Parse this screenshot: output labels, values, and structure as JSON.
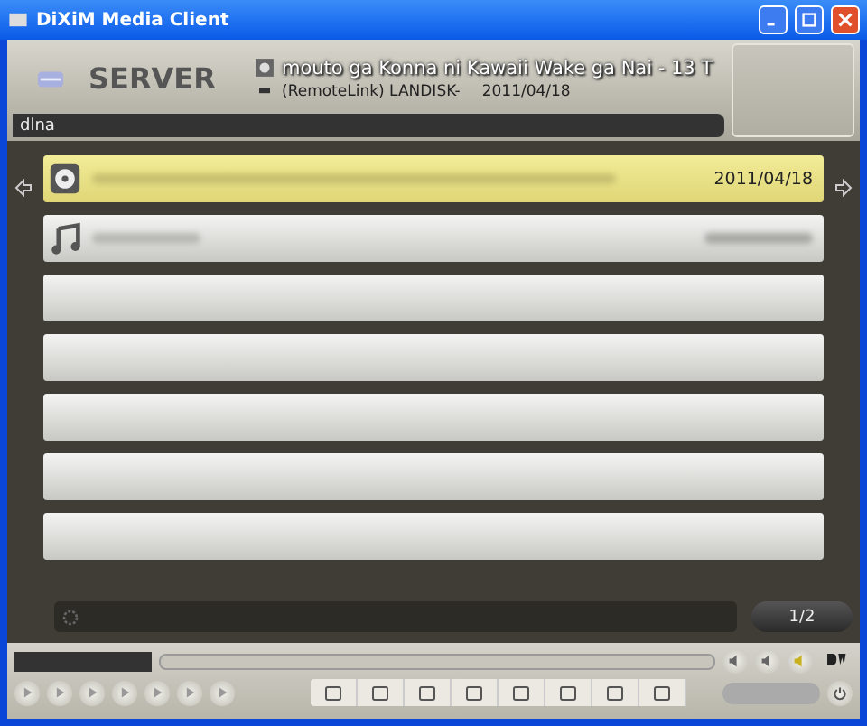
{
  "window": {
    "title": "DiXiM Media Client"
  },
  "header": {
    "server_label": "SERVER",
    "now_playing": "mouto ga Konna ni Kawaii Wake ga Nai - 13 T",
    "source": "(RemoteLink) LANDISK-",
    "date": "2011/04/18",
    "path": "dlna"
  },
  "rows": [
    {
      "kind": "video",
      "selected": true,
      "date": "2011/04/18"
    },
    {
      "kind": "music",
      "selected": false
    },
    {
      "kind": "empty",
      "selected": false
    },
    {
      "kind": "empty",
      "selected": false
    },
    {
      "kind": "empty",
      "selected": false
    },
    {
      "kind": "empty",
      "selected": false
    },
    {
      "kind": "empty",
      "selected": false
    }
  ],
  "pager": "1/2",
  "mode_switch": {
    "disabled": true
  }
}
